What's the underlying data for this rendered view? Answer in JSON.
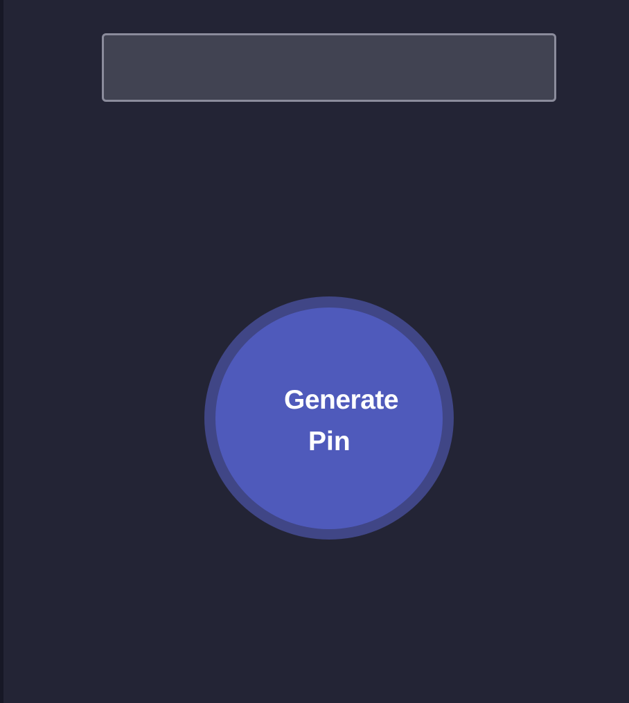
{
  "pin_display": {
    "value": "",
    "placeholder": ""
  },
  "generate_button": {
    "label_line1": "Generate",
    "label_line2": "Pin"
  },
  "colors": {
    "background": "#232435",
    "input_background": "#414352",
    "input_border": "#8b8c9c",
    "button_fill": "#4f5abb",
    "button_ring": "#404686",
    "button_text": "#ffffff"
  }
}
